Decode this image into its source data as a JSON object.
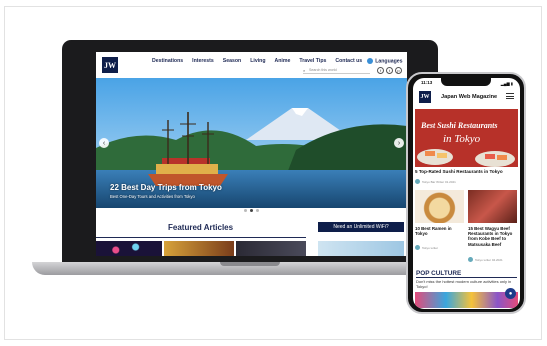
{
  "laptop": {
    "logo": "JW",
    "nav": [
      "Destinations",
      "Interests",
      "Season",
      "Living",
      "Anime",
      "Travel Tips",
      "Contact us",
      "Languages"
    ],
    "search_placeholder": "Search this world",
    "social": [
      "f",
      "t",
      "p"
    ],
    "hero": {
      "title": "22 Best Day Trips from Tokyo",
      "subtitle": "Best One-Day Tours and Activities from Tokyo"
    },
    "featured_heading": "Featured Articles",
    "wifi_banner": "Need an Unlimited WiFi?"
  },
  "phone": {
    "time": "11:13",
    "status": "▂▄▆ ▮",
    "logo": "JW",
    "site_title": "Japan Web Magazine",
    "hero_overlay_1": "Best Sushi Restaurants",
    "hero_overlay_2": "in Tokyo",
    "hero_caption": "5 Top-Rated Sushi Restaurants in Tokyo",
    "hero_author": "Tokyo Bar Writer 01.2021",
    "tiles": [
      {
        "caption": "10 Best Ramen in Tokyo",
        "author": "Tokyo writer"
      },
      {
        "caption": "15 Best Wagyu Beef Restaurants in Tokyo from Kobe Beef to Matsusaka Beef",
        "author": "Tokyo writer 04.2021"
      }
    ],
    "pop_heading": "POP CULTURE",
    "pop_sub": "Don't miss the hottest modern culture activities only in Tokyo!",
    "fab_icon": "chat-icon"
  }
}
